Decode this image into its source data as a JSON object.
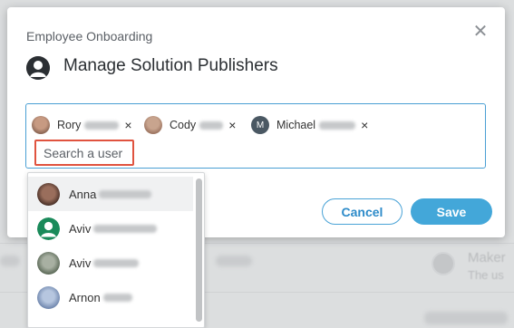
{
  "modal": {
    "subtitle": "Employee Onboarding",
    "title": "Manage Solution Publishers",
    "close_icon": "close-icon",
    "selected_users": [
      {
        "first_name": "Rory",
        "avatar": "photo",
        "remove_icon": "×"
      },
      {
        "first_name": "Cody",
        "avatar": "photo",
        "remove_icon": "×"
      },
      {
        "first_name": "Michael",
        "avatar_initial": "M",
        "remove_icon": "×"
      }
    ],
    "search": {
      "placeholder": "Search a user",
      "value": ""
    },
    "cancel_label": "Cancel",
    "save_label": "Save"
  },
  "dropdown": {
    "items": [
      {
        "first_name": "Anna",
        "avatar": "photo"
      },
      {
        "first_name": "Aviv",
        "avatar": "default-user-icon"
      },
      {
        "first_name": "Aviv",
        "avatar": "photo"
      },
      {
        "first_name": "Arnon",
        "avatar": "photo"
      }
    ]
  },
  "background": {
    "partial_text_1": "Maker",
    "partial_text_2": "The us"
  },
  "colors": {
    "accent": "#43a7d9",
    "highlight_border": "#e0533f",
    "focus_border": "#4a9fd4"
  }
}
